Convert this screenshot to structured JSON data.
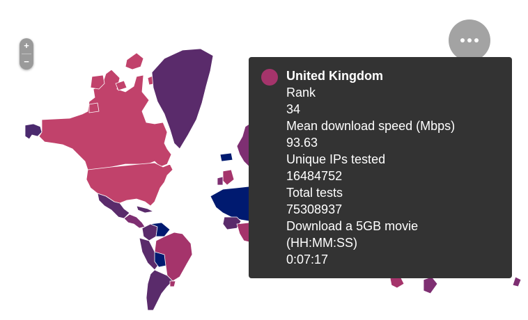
{
  "zoom": {
    "in_label": "+",
    "out_label": "−"
  },
  "menu": {
    "icon": "more-horizontal-icon"
  },
  "colors": {
    "scale_high": "#001a70",
    "scale_mid_dark": "#4b2a6e",
    "scale_mid": "#7e2f72",
    "scale_low": "#c1426b",
    "background": "#ffffff",
    "tooltip_bg": "#333333"
  },
  "tooltip": {
    "country": "United Kingdom",
    "swatch_color": "#a5346b",
    "rows": [
      {
        "label": "Rank",
        "value": "34"
      },
      {
        "label": "Mean download speed (Mbps)",
        "value": "93.63"
      },
      {
        "label": "Unique IPs tested",
        "value": "16484752"
      },
      {
        "label": "Total tests",
        "value": "75308937"
      },
      {
        "label": "Download a 5GB movie",
        "label_cont": "(HH:MM:SS)",
        "value": "0:07:17"
      }
    ]
  }
}
